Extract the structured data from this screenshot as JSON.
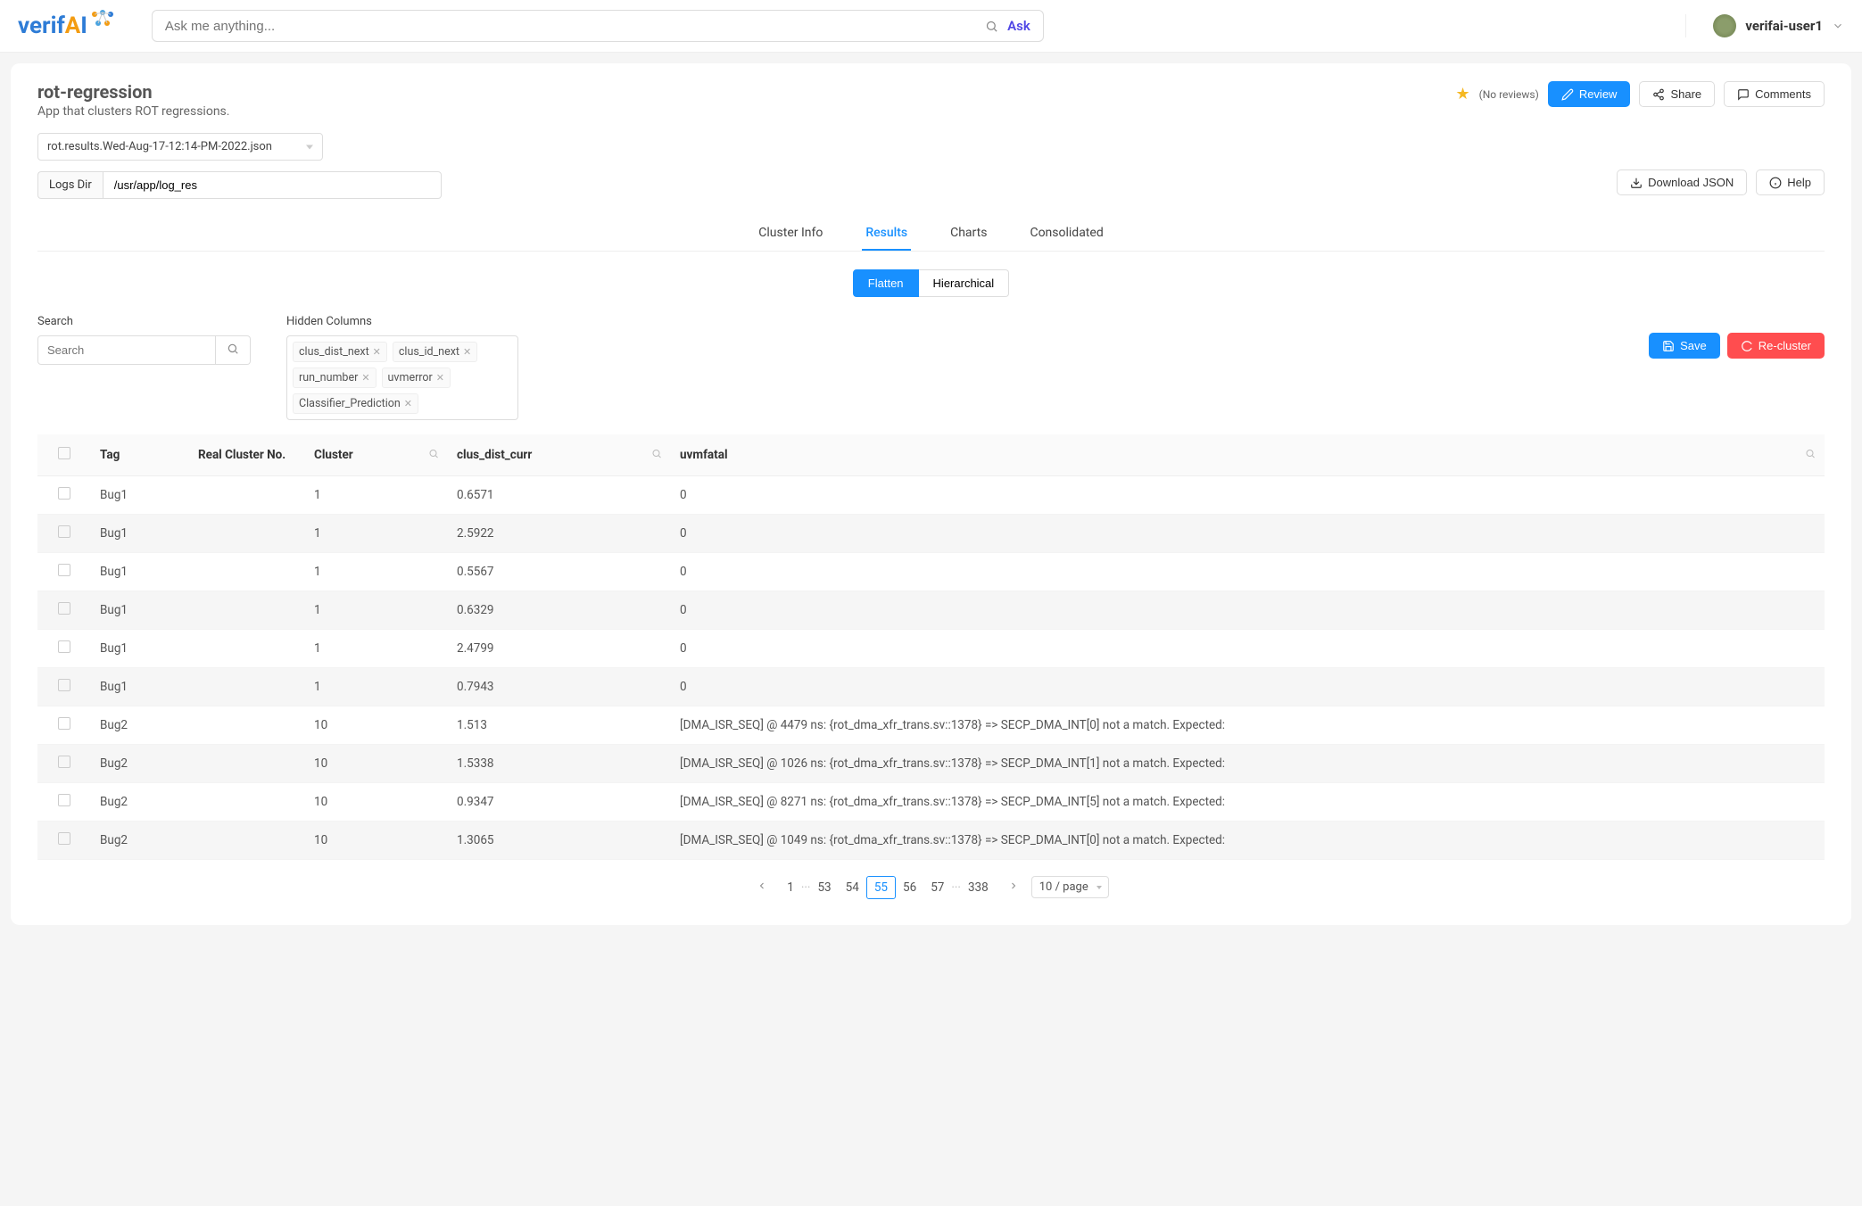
{
  "topbar": {
    "search_placeholder": "Ask me anything...",
    "ask_label": "Ask",
    "username": "verifai-user1"
  },
  "page": {
    "title": "rot-regression",
    "subtitle": "App that clusters ROT regressions.",
    "no_reviews": "(No reviews)",
    "review_btn": "Review",
    "share_btn": "Share",
    "comments_btn": "Comments",
    "file_selected": "rot.results.Wed-Aug-17-12:14-PM-2022.json",
    "logs_dir_label": "Logs Dir",
    "logs_dir_value": "/usr/app/log_res",
    "download_btn": "Download JSON",
    "help_btn": "Help"
  },
  "tabs": [
    "Cluster Info",
    "Results",
    "Charts",
    "Consolidated"
  ],
  "active_tab": "Results",
  "view": {
    "flatten": "Flatten",
    "hierarchical": "Hierarchical",
    "active": "Flatten"
  },
  "filters": {
    "search_label": "Search",
    "search_placeholder": "Search",
    "hidden_label": "Hidden Columns",
    "hidden": [
      "clus_dist_next",
      "clus_id_next",
      "run_number",
      "uvmerror",
      "Classifier_Prediction"
    ],
    "save_btn": "Save",
    "recluster_btn": "Re-cluster"
  },
  "table": {
    "headers": [
      "",
      "Tag",
      "Real Cluster No.",
      "Cluster",
      "clus_dist_curr",
      "uvmfatal"
    ],
    "rows": [
      {
        "tag": "Bug1",
        "rcn": "",
        "cluster": "1",
        "dist": "0.6571",
        "uvm": "0"
      },
      {
        "tag": "Bug1",
        "rcn": "",
        "cluster": "1",
        "dist": "2.5922",
        "uvm": "0"
      },
      {
        "tag": "Bug1",
        "rcn": "",
        "cluster": "1",
        "dist": "0.5567",
        "uvm": "0"
      },
      {
        "tag": "Bug1",
        "rcn": "",
        "cluster": "1",
        "dist": "0.6329",
        "uvm": "0"
      },
      {
        "tag": "Bug1",
        "rcn": "",
        "cluster": "1",
        "dist": "2.4799",
        "uvm": "0"
      },
      {
        "tag": "Bug1",
        "rcn": "",
        "cluster": "1",
        "dist": "0.7943",
        "uvm": "0"
      },
      {
        "tag": "Bug2",
        "rcn": "",
        "cluster": "10",
        "dist": "1.513",
        "uvm": "[DMA_ISR_SEQ] @ 4479 ns: {rot_dma_xfr_trans.sv::1378} => SECP_DMA_INT[0] not a match. Expected:"
      },
      {
        "tag": "Bug2",
        "rcn": "",
        "cluster": "10",
        "dist": "1.5338",
        "uvm": "[DMA_ISR_SEQ] @ 1026 ns: {rot_dma_xfr_trans.sv::1378} => SECP_DMA_INT[1] not a match. Expected:"
      },
      {
        "tag": "Bug2",
        "rcn": "",
        "cluster": "10",
        "dist": "0.9347",
        "uvm": "[DMA_ISR_SEQ] @ 8271 ns: {rot_dma_xfr_trans.sv::1378} => SECP_DMA_INT[5] not a match. Expected:"
      },
      {
        "tag": "Bug2",
        "rcn": "",
        "cluster": "10",
        "dist": "1.3065",
        "uvm": "[DMA_ISR_SEQ] @ 1049 ns: {rot_dma_xfr_trans.sv::1378} => SECP_DMA_INT[0] not a match. Expected:"
      }
    ]
  },
  "pagination": {
    "pages": [
      "1",
      "···",
      "53",
      "54",
      "55",
      "56",
      "57",
      "···",
      "338"
    ],
    "active": "55",
    "size": "10 / page"
  }
}
